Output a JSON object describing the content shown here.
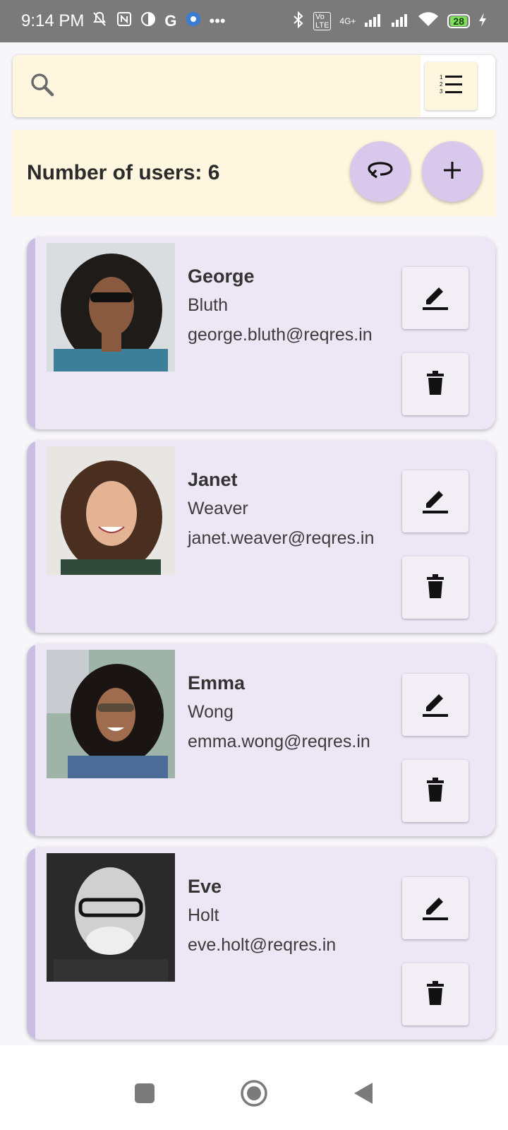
{
  "status_bar": {
    "time": "9:14 PM",
    "network": "4G+",
    "battery": "28"
  },
  "search": {
    "placeholder": ""
  },
  "header": {
    "user_count_label": "Number of users: 6"
  },
  "users": [
    {
      "first_name": "George",
      "last_name": "Bluth",
      "email": "george.bluth@reqres.in"
    },
    {
      "first_name": "Janet",
      "last_name": "Weaver",
      "email": "janet.weaver@reqres.in"
    },
    {
      "first_name": "Emma",
      "last_name": "Wong",
      "email": "emma.wong@reqres.in"
    },
    {
      "first_name": "Eve",
      "last_name": "Holt",
      "email": "eve.holt@reqres.in"
    }
  ],
  "colors": {
    "accent": "#d7c8ec",
    "card": "#ede6f5",
    "header": "#fff6df"
  }
}
